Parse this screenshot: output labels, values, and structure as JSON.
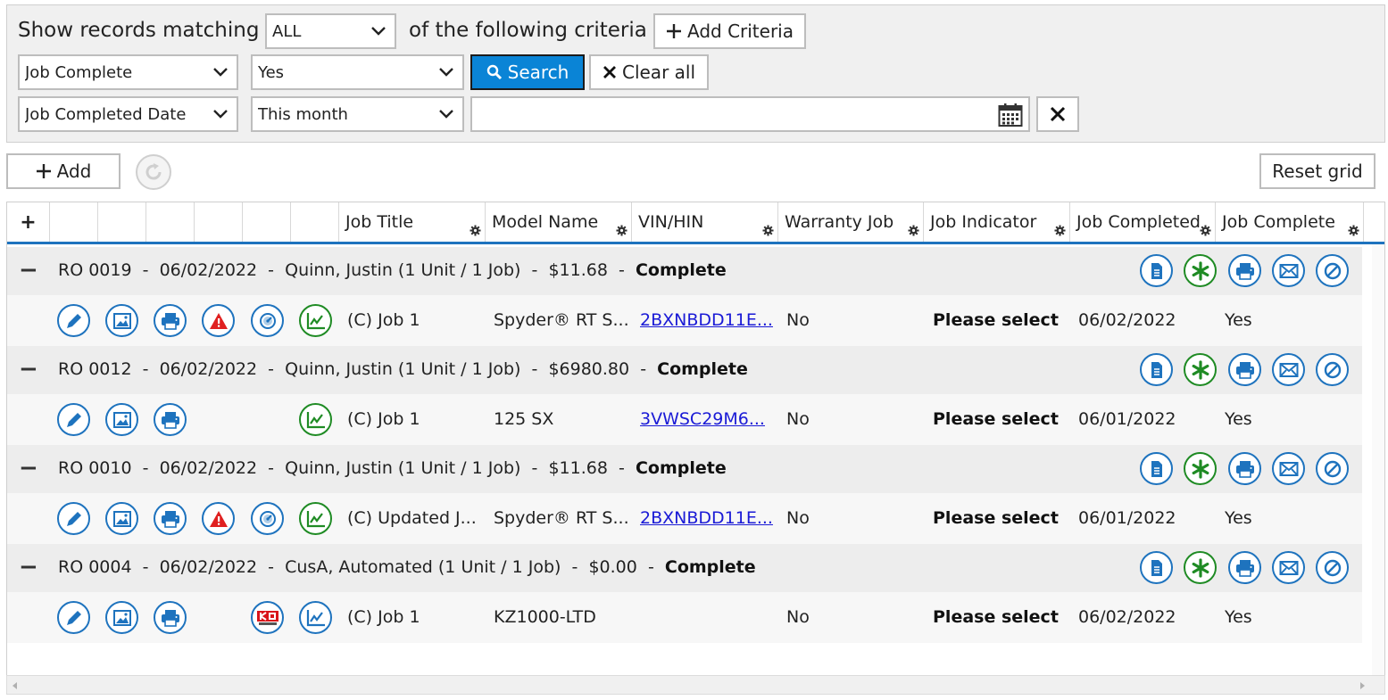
{
  "filters": {
    "show_label": "Show records matching",
    "match_value": "ALL",
    "criteria_label": "of the following criteria",
    "add_criteria_label": "Add Criteria",
    "row1": {
      "field": "Job Complete",
      "value": "Yes"
    },
    "row2": {
      "field": "Job Completed Date",
      "value": "This month",
      "date_text": ""
    },
    "search_label": "Search",
    "clear_label": "Clear all"
  },
  "toolbar": {
    "add_label": "Add",
    "reset_label": "Reset grid"
  },
  "grid": {
    "header_add": "+",
    "columns": [
      "Job Title",
      "Model Name",
      "VIN/HIN",
      "Warranty Job",
      "Job Indicator",
      "Job Completed",
      "Job Complete"
    ],
    "groups": [
      {
        "toggle": "−",
        "ro": "RO 0019",
        "date": "06/02/2022",
        "customer": "Quinn, Justin (1 Unit / 1 Job)",
        "amount": "$11.68",
        "status": "Complete",
        "row": {
          "job_title": "(C) Job 1",
          "model": "Spyder® RT S...",
          "vin": "2BXNBDD11E...",
          "warranty": "No",
          "indicator": "Please select",
          "completed": "06/02/2022",
          "complete": "Yes"
        }
      },
      {
        "toggle": "−",
        "ro": "RO 0012",
        "date": "06/02/2022",
        "customer": "Quinn, Justin (1 Unit / 1 Job)",
        "amount": "$6980.80",
        "status": "Complete",
        "row": {
          "job_title": "(C) Job 1",
          "model": "125 SX",
          "vin": "3VWSC29M6...",
          "warranty": "No",
          "indicator": "Please select",
          "completed": "06/01/2022",
          "complete": "Yes"
        }
      },
      {
        "toggle": "−",
        "ro": "RO 0010",
        "date": "06/02/2022",
        "customer": "Quinn, Justin (1 Unit / 1 Job)",
        "amount": "$11.68",
        "status": "Complete",
        "row": {
          "job_title": "(C) Updated J...",
          "model": "Spyder® RT S...",
          "vin": "2BXNBDD11E...",
          "warranty": "No",
          "indicator": "Please select",
          "completed": "06/01/2022",
          "complete": "Yes"
        }
      },
      {
        "toggle": "−",
        "ro": "RO 0004",
        "date": "06/02/2022",
        "customer": "CusA, Automated (1 Unit / 1 Job)",
        "amount": "$0.00",
        "status": "Complete",
        "row": {
          "job_title": "(C) Job 1",
          "model": "KZ1000-LTD",
          "vin": "",
          "warranty": "No",
          "indicator": "Please select",
          "completed": "06/02/2022",
          "complete": "Yes"
        }
      }
    ]
  },
  "icons": {
    "group_actions": [
      "document-icon",
      "asterisk-icon",
      "print-icon",
      "email-icon",
      "void-icon"
    ],
    "row_actions": [
      "edit-icon",
      "image-icon",
      "print-icon",
      "warning-icon",
      "gauge-icon",
      "chart-icon",
      "kawasaki-logo-icon"
    ]
  },
  "colors": {
    "accent_blue": "#1e73be",
    "search_blue": "#0a84d6",
    "green": "#1f8b24",
    "warning_red": "#e02020",
    "link": "#1a1ad6"
  }
}
